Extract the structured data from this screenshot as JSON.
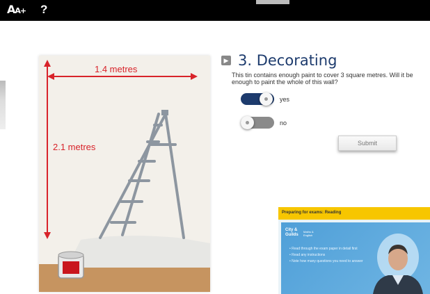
{
  "toolbar": {
    "aa_label": "A",
    "aa_small": "A+",
    "help_label": "?"
  },
  "image": {
    "width_label": "1.4 metres",
    "height_label": "2.1 metres"
  },
  "question": {
    "title": "3. Decorating",
    "text": "This tin contains enough paint to cover 3 square metres. Will it be enough to paint the whole of this wall?",
    "options": [
      {
        "label": "yes",
        "selected": true
      },
      {
        "label": "no",
        "selected": false
      }
    ],
    "submit_label": "Submit"
  },
  "video": {
    "title": "Preparing for exams: Reading",
    "logo_line1": "City &",
    "logo_line2": "Guilds",
    "logo_sub1": "Maths &",
    "logo_sub2": "English",
    "bullets": [
      "Read through the exam paper in detail first",
      "Read any instructions",
      "Note how many questions you need to answer"
    ]
  },
  "colors": {
    "accent": "#1d3b6d",
    "red_label": "#d8232a",
    "video_bar": "#f7c600"
  }
}
